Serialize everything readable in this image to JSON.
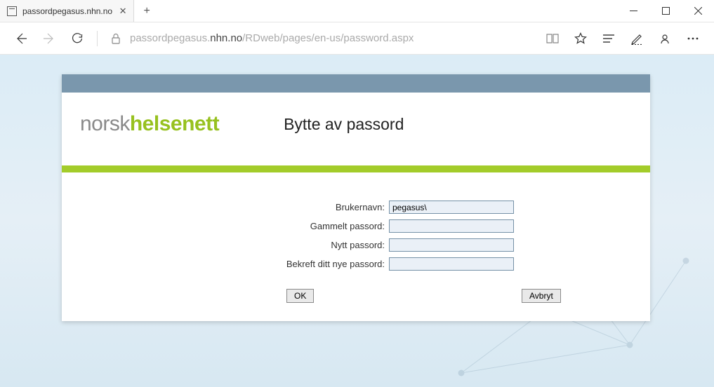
{
  "window": {
    "tab_title": "passordpegasus.nhn.no",
    "url_pre": "passordpegasus.",
    "url_host": "nhn.no",
    "url_path": "/RDweb/pages/en-us/password.aspx"
  },
  "logo": {
    "part1": "norsk",
    "part2": "helsenett"
  },
  "page_title": "Bytte av passord",
  "form": {
    "username_label": "Brukernavn:",
    "username_value": "pegasus\\",
    "oldpw_label": "Gammelt passord:",
    "oldpw_value": "",
    "newpw_label": "Nytt passord:",
    "newpw_value": "",
    "confirm_label": "Bekreft ditt nye passord:",
    "confirm_value": ""
  },
  "buttons": {
    "ok": "OK",
    "cancel": "Avbryt"
  }
}
